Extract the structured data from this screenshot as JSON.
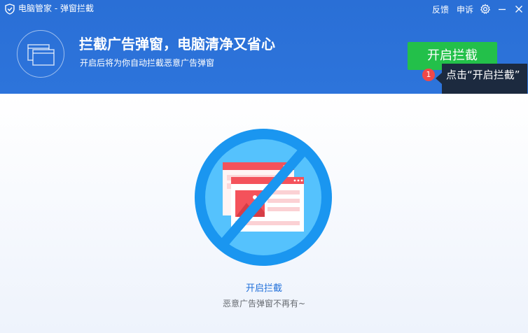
{
  "window": {
    "title": "电脑管家 - 弹窗拦截",
    "feedback": "反馈",
    "complaint": "申诉"
  },
  "header": {
    "headline": "拦截广告弹窗，电脑清净又省心",
    "subline": "开启后将为你自动拦截恶意广告弹窗",
    "enable_button": "开启拦截"
  },
  "tooltip": {
    "step": "1",
    "text": "点击“开启拦截”"
  },
  "main": {
    "title": "开启拦截",
    "subtitle": "恶意广告弹窗不再有~"
  },
  "icons": {
    "app_logo": "shield-logo",
    "settings": "gear-icon",
    "minimize": "minimize-icon",
    "close": "close-icon",
    "feature": "windows-icon",
    "illustration": "blocked-popup-illustration"
  },
  "colors": {
    "header_blue": "#2a6fd6",
    "button_green": "#23c04a",
    "accent_blue": "#1f6fd9",
    "badge_red": "#f04848",
    "tooltip_bg": "#1c2a3f"
  }
}
